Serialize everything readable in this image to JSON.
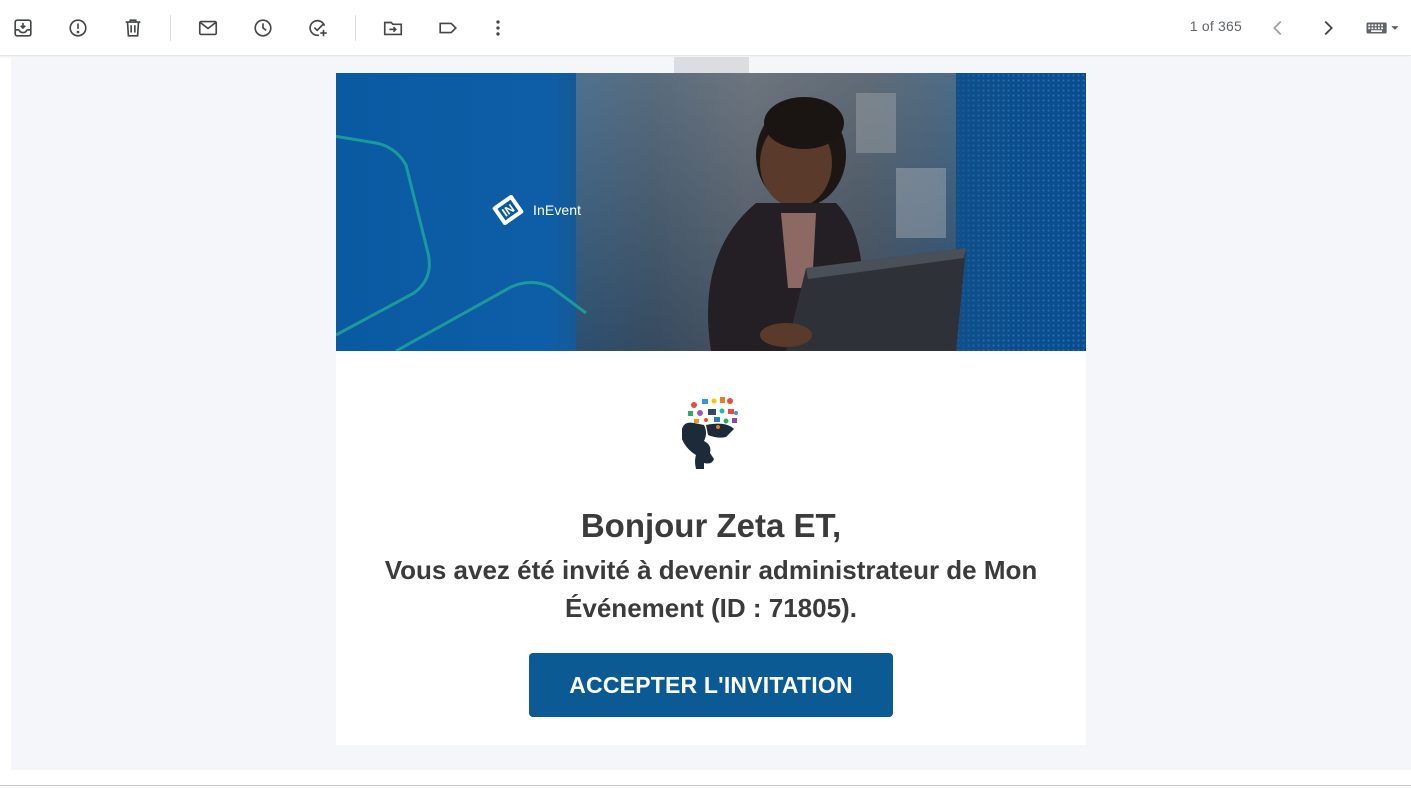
{
  "toolbar": {
    "icons": [
      "archive-icon",
      "report-spam-icon",
      "delete-icon",
      "mark-unread-icon",
      "snooze-icon",
      "add-to-tasks-icon",
      "move-to-icon",
      "label-icon",
      "more-icon"
    ],
    "pager_text": "1 of 365",
    "nav": [
      "newer-icon",
      "older-icon"
    ],
    "input_tool": "keyboard-icon"
  },
  "email": {
    "banner": {
      "brand": "InEvent",
      "colors": {
        "blue": "#0a5aa2",
        "dark_blue": "#0a4d8e",
        "teal_line": "#1fa99a"
      }
    },
    "illustration": "head-with-ideas-illustration",
    "greeting": "Bonjour Zeta ET,",
    "message": "Vous avez été invité à devenir administrateur de Mon Événement (ID : 71805).",
    "cta_label": "ACCEPTER L'INVITATION",
    "cta_color": "#0b5a94"
  }
}
